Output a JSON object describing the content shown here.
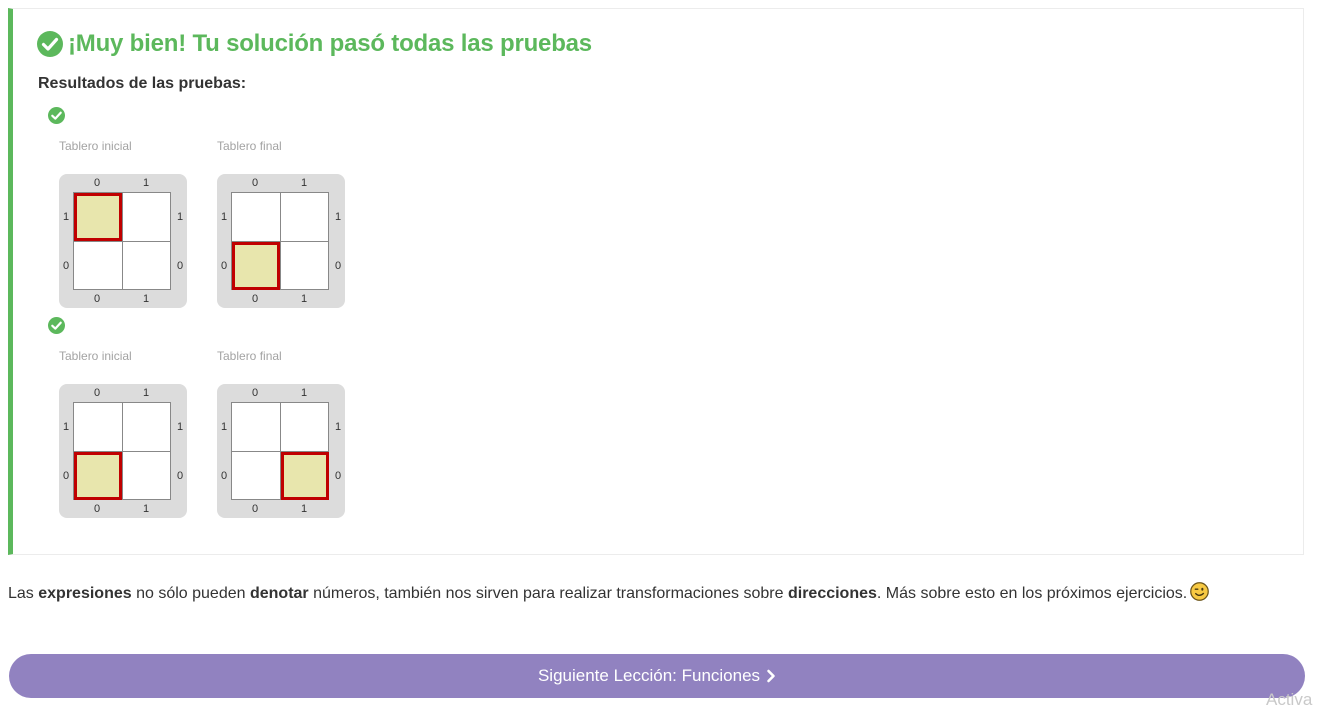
{
  "result": {
    "title": "¡Muy bien! Tu solución pasó todas las pruebas",
    "section_label": "Resultados de las pruebas:",
    "tests": [
      {
        "initial": {
          "caption": "Tablero inicial",
          "head": {
            "x": 0,
            "y": 1
          }
        },
        "final": {
          "caption": "Tablero final",
          "head": {
            "x": 0,
            "y": 0
          }
        }
      },
      {
        "initial": {
          "caption": "Tablero inicial",
          "head": {
            "x": 0,
            "y": 0
          }
        },
        "final": {
          "caption": "Tablero final",
          "head": {
            "x": 1,
            "y": 0
          }
        }
      }
    ],
    "board": {
      "columns": [
        "0",
        "1"
      ],
      "rows": [
        "1",
        "0"
      ]
    }
  },
  "explanation": {
    "p1": "Las ",
    "b1": "expresiones",
    "p2": " no sólo pueden ",
    "b2": "denotar",
    "p3": " números, también nos sirven para realizar transformaciones sobre ",
    "b3": "direcciones",
    "p4": ". Más sobre esto en los próximos ejercicios.",
    "emoji": "wink-emoji-icon"
  },
  "next_button": {
    "label": "Siguiente Lección: Funciones",
    "icon": "chevron-right-icon"
  },
  "watermark": "Activa",
  "colors": {
    "success": "#5cb85c",
    "head_fill": "#e8e6ad",
    "head_border": "#c00000",
    "board_bg": "#dcdcdc",
    "button": "#9182c0"
  }
}
